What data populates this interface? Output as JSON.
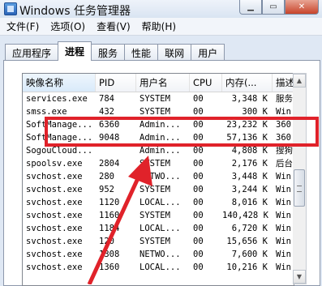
{
  "window": {
    "title": "Windows 任务管理器",
    "min_label": "▁",
    "max_label": "▭",
    "close_label": "✕"
  },
  "menu": [
    "文件(F)",
    "选项(O)",
    "查看(V)",
    "帮助(H)"
  ],
  "tabs": [
    "应用程序",
    "进程",
    "服务",
    "性能",
    "联网",
    "用户"
  ],
  "active_tab": "进程",
  "columns": [
    "映像名称",
    "PID",
    "用户名",
    "CPU",
    "内存(...",
    "描述"
  ],
  "rows": [
    [
      "services.exe",
      "784",
      "SYSTEM",
      "00",
      "3,348 K",
      "服务"
    ],
    [
      "smss.exe",
      "432",
      "SYSTEM",
      "00",
      "300 K",
      "Win"
    ],
    [
      "SoftManage...",
      "6360",
      "Admin...",
      "00",
      "23,232 K",
      "360"
    ],
    [
      "SoftManage...",
      "9048",
      "Admin...",
      "00",
      "57,136 K",
      "360"
    ],
    [
      "SogouCloud...",
      "",
      "Admin...",
      "00",
      "4,808 K",
      "搜狗"
    ],
    [
      "spoolsv.exe",
      "2804",
      "SYSTEM",
      "00",
      "2,176 K",
      "后台"
    ],
    [
      "svchost.exe",
      "280",
      "NETWO...",
      "00",
      "3,448 K",
      "Win"
    ],
    [
      "svchost.exe",
      "952",
      "SYSTEM",
      "00",
      "3,244 K",
      "Win"
    ],
    [
      "svchost.exe",
      "1120",
      "LOCAL...",
      "00",
      "8,016 K",
      "Win"
    ],
    [
      "svchost.exe",
      "1160",
      "SYSTEM",
      "00",
      "140,428 K",
      "Win"
    ],
    [
      "svchost.exe",
      "1184",
      "LOCAL...",
      "00",
      "6,720 K",
      "Win"
    ],
    [
      "svchost.exe",
      "120",
      "SYSTEM",
      "00",
      "15,656 K",
      "Win"
    ],
    [
      "svchost.exe",
      "1308",
      "NETWO...",
      "00",
      "7,600 K",
      "Win"
    ],
    [
      "svchost.exe",
      "1360",
      "LOCAL...",
      "00",
      "10,216 K",
      "Win"
    ]
  ],
  "highlighted_rows": [
    2,
    3
  ],
  "colors": {
    "highlight": "#e0222a",
    "arrow": "#e0222a",
    "title_bar": "#dfe8f4"
  },
  "icons": [
    "app-icon",
    "minimize-icon",
    "maximize-icon",
    "close-icon",
    "scroll-up-icon",
    "scroll-down-icon"
  ]
}
